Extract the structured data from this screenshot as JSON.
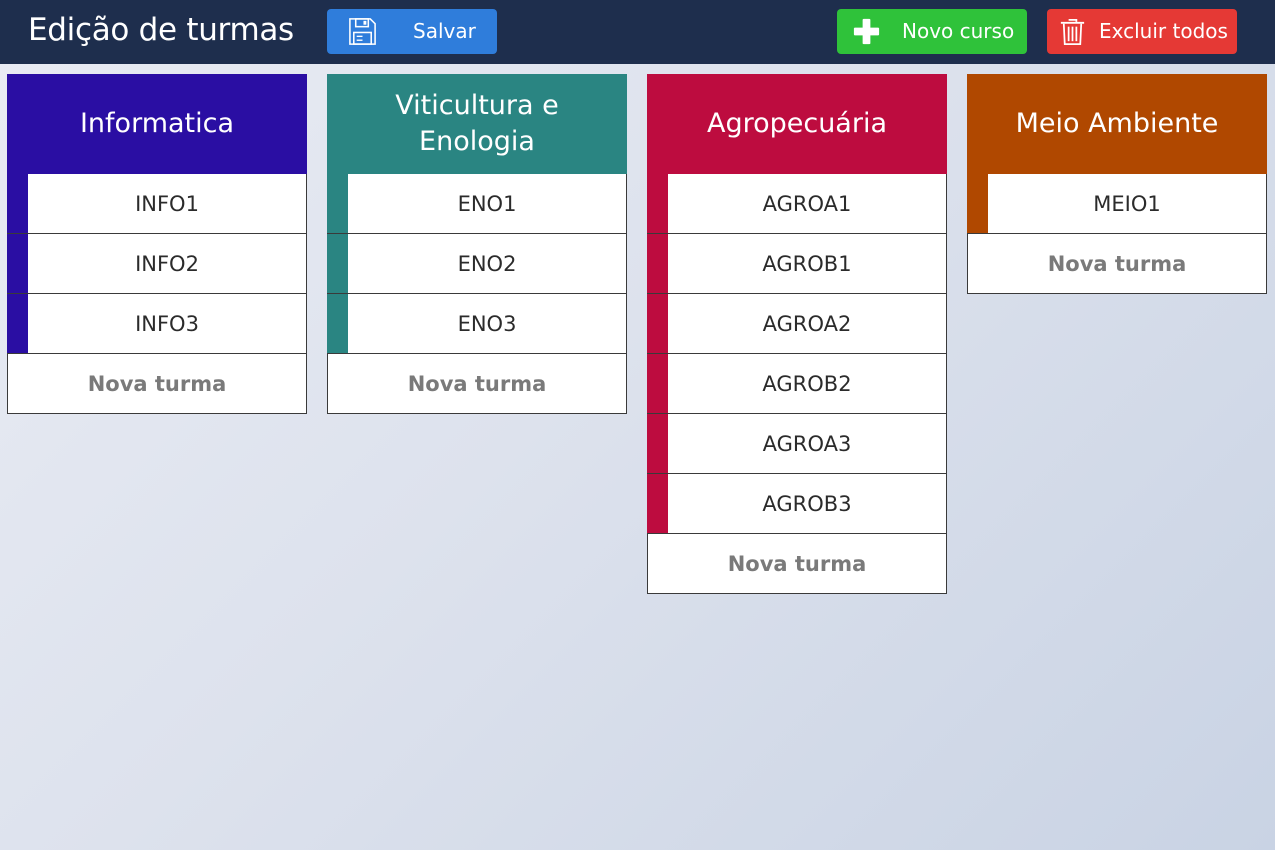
{
  "header": {
    "title": "Edição de turmas",
    "save": {
      "label": "Salvar",
      "icon": "save-icon"
    },
    "new_course": {
      "label": "Novo curso",
      "icon": "plus-icon"
    },
    "delete_all": {
      "label": "Excluir todos",
      "icon": "trash-icon"
    }
  },
  "colors": {
    "header_bg": "#1e2e4d",
    "save": "#2f7ddb",
    "new": "#2fc23a",
    "delete": "#e53935"
  },
  "new_class_label": "Nova turma",
  "courses": [
    {
      "name": "Informatica",
      "color": "#2a0ea3",
      "classes": [
        "INFO1",
        "INFO2",
        "INFO3"
      ]
    },
    {
      "name": "Viticultura e Enologia",
      "color": "#2a8582",
      "classes": [
        "ENO1",
        "ENO2",
        "ENO3"
      ]
    },
    {
      "name": "Agropecuária",
      "color": "#bd0c3f",
      "classes": [
        "AGROA1",
        "AGROB1",
        "AGROA2",
        "AGROB2",
        "AGROA3",
        "AGROB3"
      ]
    },
    {
      "name": "Meio Ambiente",
      "color": "#b04800",
      "classes": [
        "MEIO1"
      ]
    }
  ]
}
